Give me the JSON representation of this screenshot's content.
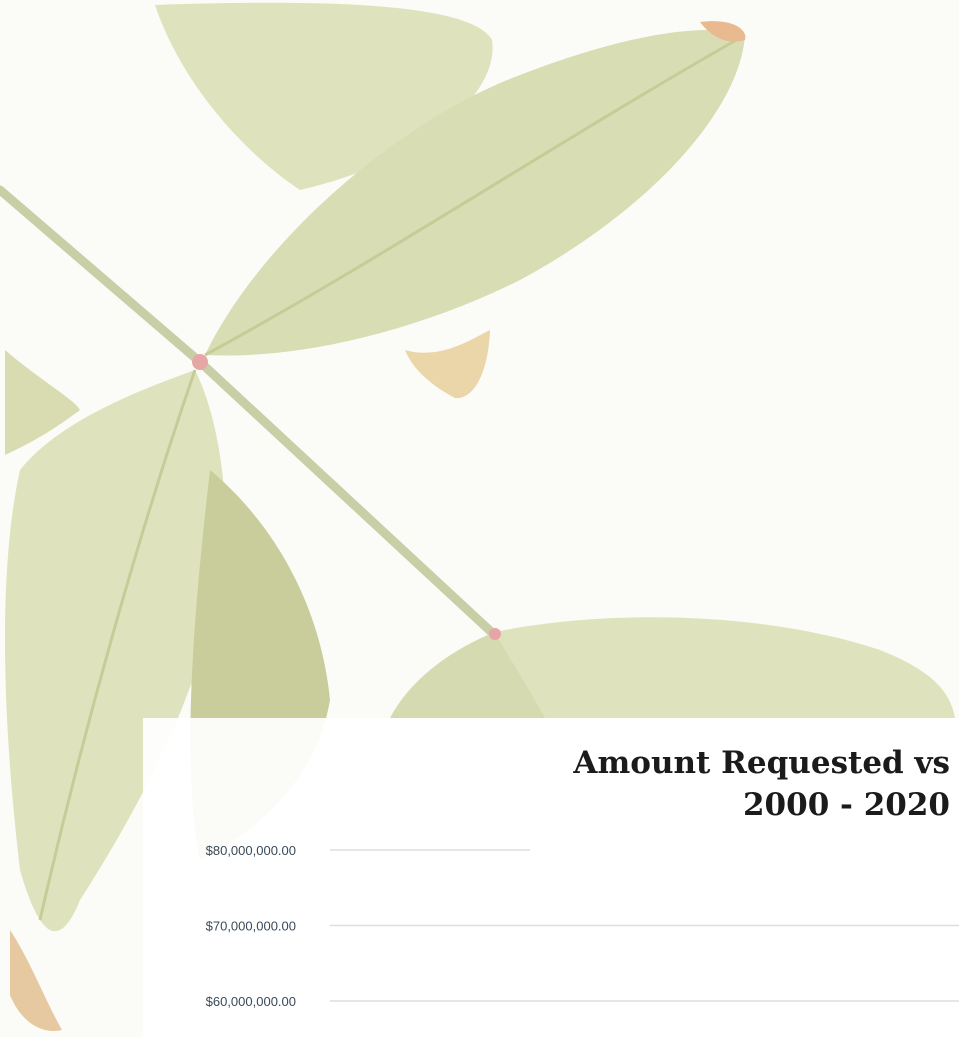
{
  "chart_data": {
    "type": "bar",
    "title": "Amount Requested vs",
    "subtitle": "2000 - 2020",
    "xlabel": "",
    "ylabel": "",
    "y_ticks": [
      80000000,
      70000000,
      60000000
    ],
    "y_tick_labels": [
      "$80,000,000.00",
      "$70,000,000.00",
      "$60,000,000.00"
    ],
    "grid": true,
    "categories": [],
    "series": []
  },
  "colors": {
    "leaf_fill": "#dfe3bd",
    "leaf_vein": "#c9cf9f",
    "leaf_tip": "#e9b990",
    "stem": "#c8cfa6",
    "node": "#e6a6a6",
    "gridline": "#d9e0e0",
    "tick_label": "#3a4a5a",
    "title": "#1b1b1b"
  }
}
